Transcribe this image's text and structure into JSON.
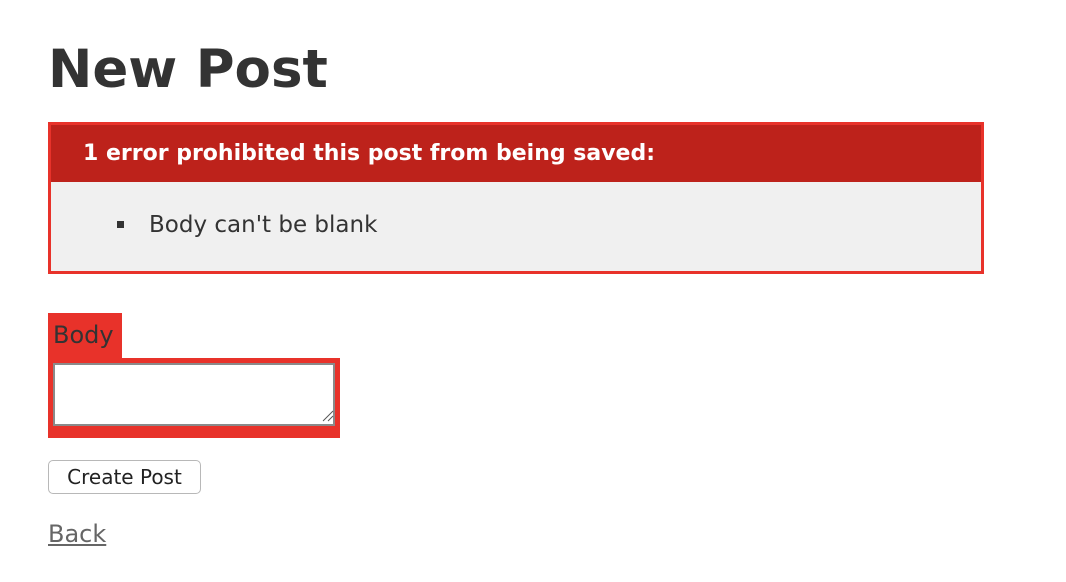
{
  "page": {
    "title": "New Post"
  },
  "error_explanation": {
    "header": "1 error prohibited this post from being saved:",
    "messages": [
      "Body can't be blank"
    ]
  },
  "form": {
    "body_label": "Body",
    "body_value": "",
    "submit_label": "Create Post"
  },
  "links": {
    "back": "Back"
  },
  "colors": {
    "error_border": "#e8322a",
    "error_header_bg": "#bd221b",
    "error_body_bg": "#f0f0f0",
    "text": "#333333",
    "link": "#666666"
  }
}
